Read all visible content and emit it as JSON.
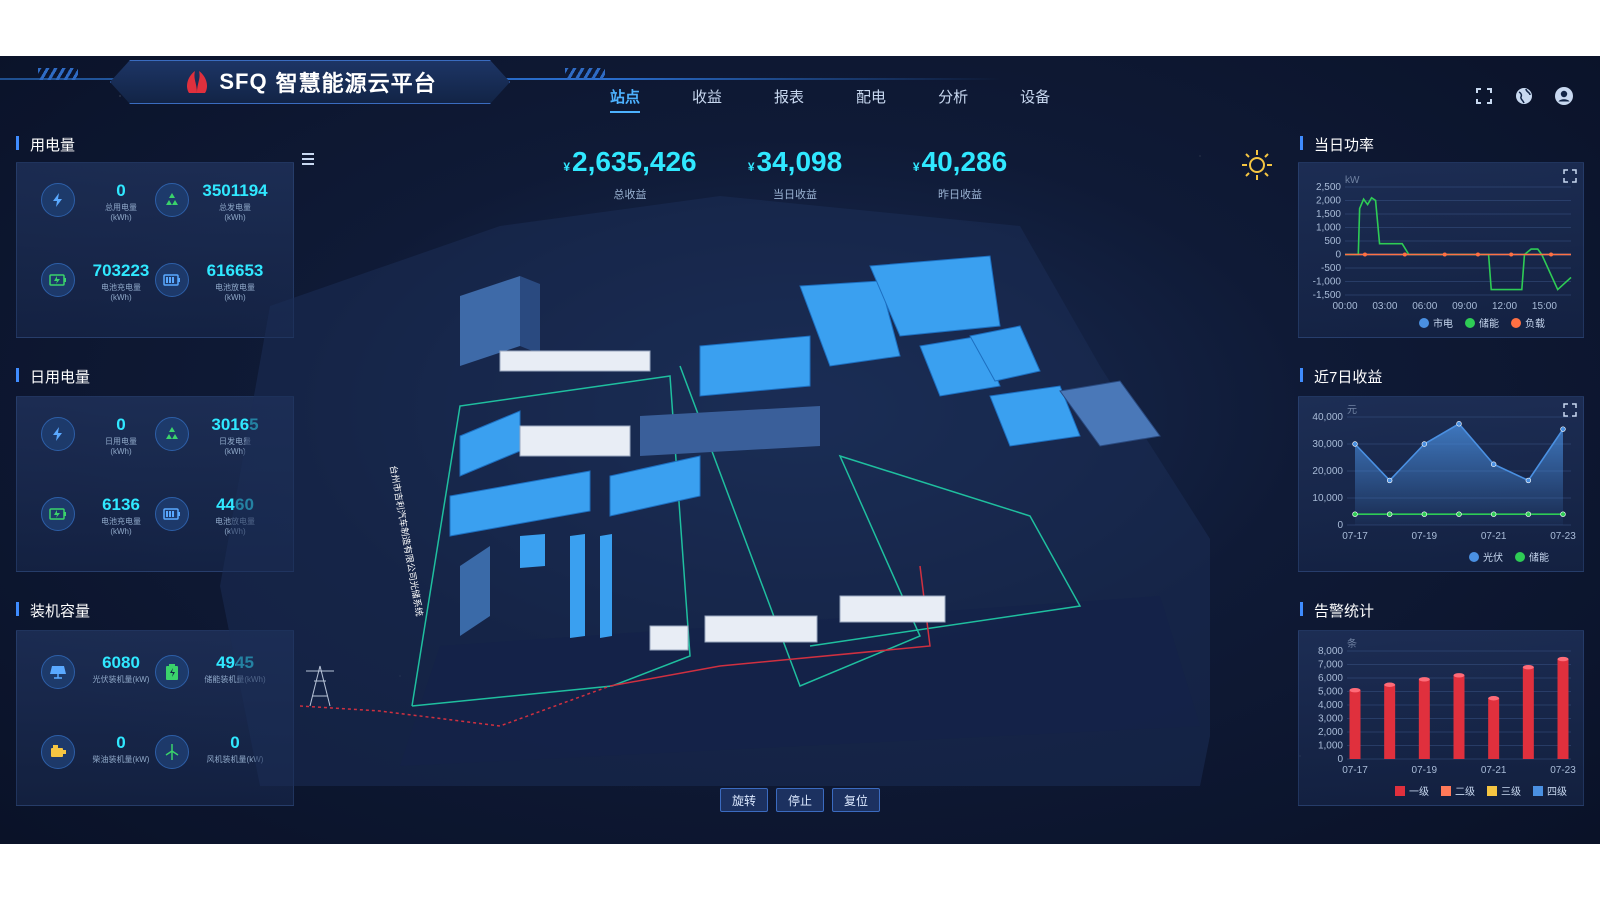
{
  "brand": {
    "name": "SFQ",
    "title": "智慧能源云平台"
  },
  "nav": [
    {
      "label": "站点",
      "active": true
    },
    {
      "label": "收益"
    },
    {
      "label": "报表"
    },
    {
      "label": "配电"
    },
    {
      "label": "分析"
    },
    {
      "label": "设备"
    }
  ],
  "top_icons": [
    "fullscreen-icon",
    "globe-icon",
    "user-icon"
  ],
  "left": {
    "power_usage": {
      "title": "用电量",
      "stats": [
        {
          "icon": "lightning-icon",
          "value": "0",
          "label": "总用电量",
          "unit": "(kWh)"
        },
        {
          "icon": "recycle-icon",
          "value": "3501194",
          "label": "总发电量",
          "unit": "(kWh)"
        },
        {
          "icon": "battery-charge-icon",
          "value": "703223",
          "label": "电池充电量",
          "unit": "(kWh)"
        },
        {
          "icon": "battery-discharge-icon",
          "value": "616653",
          "label": "电池放电量",
          "unit": "(kWh)"
        }
      ]
    },
    "daily_usage": {
      "title": "日用电量",
      "stats": [
        {
          "icon": "lightning-icon",
          "value": "0",
          "label": "日用电量",
          "unit": "(kWh)"
        },
        {
          "icon": "recycle-icon",
          "value": "30165",
          "label": "日发电量",
          "unit": "(kWh)"
        },
        {
          "icon": "battery-charge-icon",
          "value": "6136",
          "label": "电池充电量",
          "unit": "(kWh)"
        },
        {
          "icon": "battery-discharge-icon",
          "value": "4460",
          "label": "电池放电量",
          "unit": "(kWh)"
        }
      ]
    },
    "capacity": {
      "title": "装机容量",
      "stats": [
        {
          "icon": "solar-panel-icon",
          "value": "6080",
          "label": "光伏装机量(kW)"
        },
        {
          "icon": "storage-icon",
          "value": "4945",
          "label": "储能装机量(kWh)"
        },
        {
          "icon": "diesel-generator-icon",
          "value": "0",
          "label": "柴油装机量(kW)"
        },
        {
          "icon": "wind-turbine-icon",
          "value": "0",
          "label": "风机装机量(kW)"
        }
      ]
    }
  },
  "center": {
    "kpis": [
      {
        "currency": "¥",
        "value": "2,635,426",
        "label": "总收益"
      },
      {
        "currency": "¥",
        "value": "34,098",
        "label": "当日收益"
      },
      {
        "currency": "¥",
        "value": "40,286",
        "label": "昨日收益"
      }
    ],
    "map_label": "台州市吉利汽车制造有限公司光储系统",
    "controls": [
      "旋转",
      "停止",
      "复位"
    ]
  },
  "right": {
    "power_chart_title": "当日功率",
    "revenue_chart_title": "近7日收益",
    "alarm_chart_title": "告警统计"
  },
  "chart_data": [
    {
      "type": "line",
      "title": "当日功率",
      "ylabel": "kW",
      "x": [
        "00:00",
        "03:00",
        "06:00",
        "09:00",
        "12:00",
        "15:00"
      ],
      "ylim": [
        -1500,
        2500
      ],
      "yticks": [
        2500,
        2000,
        1500,
        1000,
        500,
        0,
        -500,
        -1000,
        -1500
      ],
      "series": [
        {
          "name": "市电",
          "color": "#4a90e2",
          "hours": [
            0,
            17
          ],
          "values": [
            0,
            0
          ]
        },
        {
          "name": "储能",
          "color": "#2ecc55",
          "hours": [
            0,
            1.0,
            1.1,
            1.4,
            1.7,
            2.0,
            2.3,
            2.6,
            3.0,
            4.3,
            4.8,
            5.2,
            5.5,
            10.8,
            11.0,
            13.3,
            13.5,
            14.0,
            14.5,
            14.8,
            16.0,
            17
          ],
          "values": [
            0,
            0,
            1700,
            2050,
            1850,
            2100,
            2000,
            400,
            400,
            400,
            0,
            0,
            0,
            0,
            -1300,
            -1300,
            0,
            200,
            200,
            0,
            -1300,
            -850
          ]
        },
        {
          "name": "负载",
          "color": "#ff7043",
          "hours": [
            0,
            1.5,
            4.5,
            7.5,
            10.0,
            12.5,
            15.5,
            17
          ],
          "values": [
            0,
            0,
            0,
            0,
            0,
            0,
            0,
            0
          ]
        }
      ]
    },
    {
      "type": "area",
      "title": "近7日收益",
      "ylabel": "元",
      "categories": [
        "07-17",
        "07-18",
        "07-19",
        "07-20",
        "07-21",
        "07-22",
        "07-23"
      ],
      "xticks": [
        "07-17",
        "07-19",
        "07-21",
        "07-23"
      ],
      "ylim": [
        0,
        40000
      ],
      "yticks": [
        40000,
        30000,
        20000,
        10000,
        0
      ],
      "series": [
        {
          "name": "光伏",
          "color": "#4a90e2",
          "values": [
            30000,
            16500,
            30000,
            37500,
            22500,
            16500,
            35500
          ]
        },
        {
          "name": "储能",
          "color": "#2ecc55",
          "values": [
            4000,
            4000,
            4000,
            4000,
            4000,
            4000,
            4000
          ]
        }
      ]
    },
    {
      "type": "bar",
      "title": "告警统计",
      "ylabel": "条",
      "categories": [
        "07-17",
        "07-18",
        "07-19",
        "07-20",
        "07-21",
        "07-22",
        "07-23"
      ],
      "xticks": [
        "07-17",
        "07-19",
        "07-21",
        "07-23"
      ],
      "ylim": [
        0,
        8000
      ],
      "yticks": [
        8000,
        7000,
        6000,
        5000,
        4000,
        3000,
        2000,
        1000,
        0
      ],
      "series": [
        {
          "name": "一级",
          "color": "#e0303d",
          "values": [
            5100,
            5500,
            5900,
            6200,
            4500,
            6800,
            7400
          ]
        },
        {
          "name": "二级",
          "color": "#ff7a59",
          "values": [
            0,
            0,
            0,
            0,
            0,
            0,
            0
          ]
        },
        {
          "name": "三级",
          "color": "#f5c542",
          "values": [
            0,
            0,
            0,
            0,
            0,
            0,
            0
          ]
        },
        {
          "name": "四级",
          "color": "#4a90e2",
          "values": [
            0,
            0,
            0,
            0,
            0,
            0,
            0
          ]
        }
      ]
    }
  ]
}
